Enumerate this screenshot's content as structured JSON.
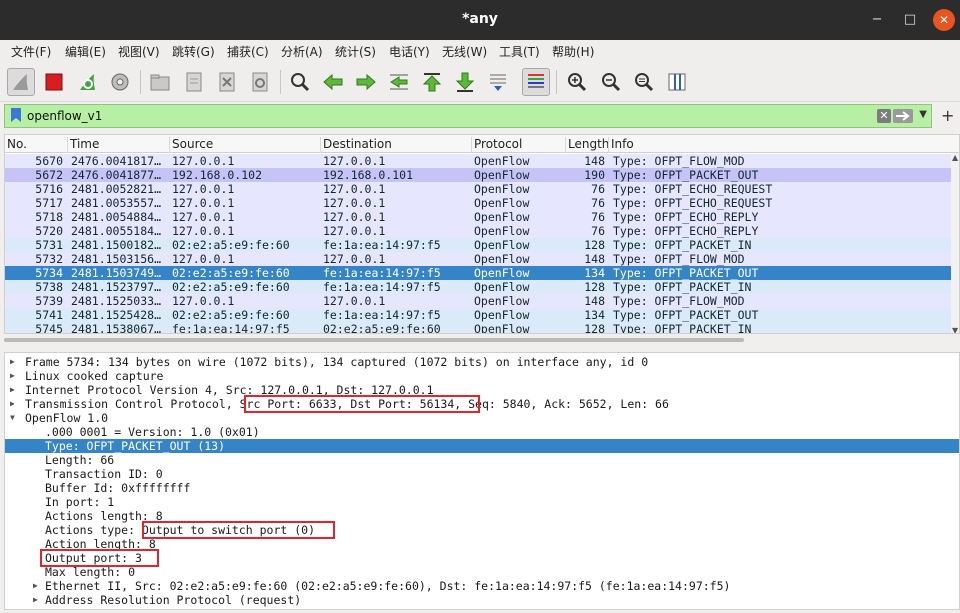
{
  "window": {
    "title": "*any",
    "minimize": "−",
    "maximize": "□",
    "close": "✕"
  },
  "menu": [
    "文件(F)",
    "编辑(E)",
    "视图(V)",
    "跳转(G)",
    "捕获(C)",
    "分析(A)",
    "统计(S)",
    "电话(Y)",
    "无线(W)",
    "工具(T)",
    "帮助(H)"
  ],
  "toolbar": {
    "icons": [
      "shark-fin-start-icon",
      "stop-capture-icon",
      "restart-capture-icon",
      "capture-options-icon",
      "open-file-icon",
      "save-file-icon",
      "close-file-icon",
      "reload-file-icon",
      "find-packet-icon",
      "go-back-icon",
      "go-forward-icon",
      "go-to-packet-icon",
      "go-first-icon",
      "go-last-icon",
      "auto-scroll-icon",
      "colorize-icon",
      "zoom-in-icon",
      "zoom-out-icon",
      "zoom-normal-icon",
      "resize-columns-icon"
    ]
  },
  "filter": {
    "value": "openflow_v1",
    "plus": "+"
  },
  "packet_list": {
    "columns": [
      "No.",
      "Time",
      "Source",
      "Destination",
      "Protocol",
      "Length",
      "Info"
    ],
    "rows": [
      {
        "no": "5670",
        "time": "2476.0041817…",
        "src": "127.0.0.1",
        "dst": "127.0.0.1",
        "proto": "OpenFlow",
        "len": "148",
        "info": "Type: OFPT_FLOW_MOD",
        "color": "#e7e6ff"
      },
      {
        "no": "5672",
        "time": "2476.0041877…",
        "src": "192.168.0.102",
        "dst": "192.168.0.101",
        "proto": "OpenFlow",
        "len": "190",
        "info": "Type: OFPT_PACKET_OUT",
        "color": "#c6c4f7"
      },
      {
        "no": "5716",
        "time": "2481.0052821…",
        "src": "127.0.0.1",
        "dst": "127.0.0.1",
        "proto": "OpenFlow",
        "len": "76",
        "info": "Type: OFPT_ECHO_REQUEST",
        "color": "#e7e6ff"
      },
      {
        "no": "5717",
        "time": "2481.0053557…",
        "src": "127.0.0.1",
        "dst": "127.0.0.1",
        "proto": "OpenFlow",
        "len": "76",
        "info": "Type: OFPT_ECHO_REQUEST",
        "color": "#e7e6ff"
      },
      {
        "no": "5718",
        "time": "2481.0054884…",
        "src": "127.0.0.1",
        "dst": "127.0.0.1",
        "proto": "OpenFlow",
        "len": "76",
        "info": "Type: OFPT_ECHO_REPLY",
        "color": "#e7e6ff"
      },
      {
        "no": "5720",
        "time": "2481.0055184…",
        "src": "127.0.0.1",
        "dst": "127.0.0.1",
        "proto": "OpenFlow",
        "len": "76",
        "info": "Type: OFPT_ECHO_REPLY",
        "color": "#e7e6ff"
      },
      {
        "no": "5731",
        "time": "2481.1500182…",
        "src": "02:e2:a5:e9:fe:60",
        "dst": "fe:1a:ea:14:97:f5",
        "proto": "OpenFlow",
        "len": "128",
        "info": "Type: OFPT_PACKET_IN",
        "color": "#dbeaf8"
      },
      {
        "no": "5732",
        "time": "2481.1503156…",
        "src": "127.0.0.1",
        "dst": "127.0.0.1",
        "proto": "OpenFlow",
        "len": "148",
        "info": "Type: OFPT_FLOW_MOD",
        "color": "#e7e6ff"
      },
      {
        "no": "5734",
        "time": "2481.1503749…",
        "src": "02:e2:a5:e9:fe:60",
        "dst": "fe:1a:ea:14:97:f5",
        "proto": "OpenFlow",
        "len": "134",
        "info": "Type: OFPT_PACKET_OUT",
        "color": "#3584c8",
        "selected": true
      },
      {
        "no": "5738",
        "time": "2481.1523797…",
        "src": "02:e2:a5:e9:fe:60",
        "dst": "fe:1a:ea:14:97:f5",
        "proto": "OpenFlow",
        "len": "128",
        "info": "Type: OFPT_PACKET_IN",
        "color": "#dbeaf8"
      },
      {
        "no": "5739",
        "time": "2481.1525033…",
        "src": "127.0.0.1",
        "dst": "127.0.0.1",
        "proto": "OpenFlow",
        "len": "148",
        "info": "Type: OFPT_FLOW_MOD",
        "color": "#e7e6ff"
      },
      {
        "no": "5741",
        "time": "2481.1525428…",
        "src": "02:e2:a5:e9:fe:60",
        "dst": "fe:1a:ea:14:97:f5",
        "proto": "OpenFlow",
        "len": "134",
        "info": "Type: OFPT_PACKET_OUT",
        "color": "#dbeaf8"
      },
      {
        "no": "5745",
        "time": "2481.1538067…",
        "src": "fe:1a:ea:14:97:f5",
        "dst": "02:e2:a5:e9:fe:60",
        "proto": "OpenFlow",
        "len": "128",
        "info": "Type: OFPT_PACKET_IN",
        "color": "#dbeaf8"
      }
    ]
  },
  "details": [
    {
      "text": "Frame 5734: 134 bytes on wire (1072 bits), 134 captured (1072 bits) on interface any, id 0",
      "arrow": "▶",
      "indent": 0
    },
    {
      "text": "Linux cooked capture",
      "arrow": "▶",
      "indent": 0
    },
    {
      "text": "Internet Protocol Version 4, Src: 127.0.0.1, Dst: 127.0.0.1",
      "arrow": "▶",
      "indent": 0
    },
    {
      "text": "Transmission Control Protocol, Src Port: 6633, Dst Port: 56134, Seq: 5840, Ack: 5652, Len: 66",
      "arrow": "▶",
      "indent": 0
    },
    {
      "text": "OpenFlow 1.0",
      "arrow": "▼",
      "indent": 0
    },
    {
      "text": ".000 0001 = Version: 1.0 (0x01)",
      "arrow": "",
      "indent": 1
    },
    {
      "text": "Type: OFPT_PACKET_OUT (13)",
      "arrow": "",
      "indent": 1,
      "selected": true
    },
    {
      "text": "Length: 66",
      "arrow": "",
      "indent": 1
    },
    {
      "text": "Transaction ID: 0",
      "arrow": "",
      "indent": 1
    },
    {
      "text": "Buffer Id: 0xffffffff",
      "arrow": "",
      "indent": 1
    },
    {
      "text": "In port: 1",
      "arrow": "",
      "indent": 1
    },
    {
      "text": "Actions length: 8",
      "arrow": "",
      "indent": 1
    },
    {
      "text": "Actions type: Output to switch port (0)",
      "arrow": "",
      "indent": 1
    },
    {
      "text": "Action length: 8",
      "arrow": "",
      "indent": 1
    },
    {
      "text": "Output port: 3",
      "arrow": "",
      "indent": 1
    },
    {
      "text": "Max length: 0",
      "arrow": "",
      "indent": 1
    },
    {
      "text": "Ethernet II, Src: 02:e2:a5:e9:fe:60 (02:e2:a5:e9:fe:60), Dst: fe:1a:ea:14:97:f5 (fe:1a:ea:14:97:f5)",
      "arrow": "▶",
      "indent": 2
    },
    {
      "text": "Address Resolution Protocol (request)",
      "arrow": "▶",
      "indent": 2
    }
  ],
  "colors": {
    "selection": "#3584c8",
    "filter_ok": "#b7f0a4",
    "annotation": "#e0262c"
  }
}
